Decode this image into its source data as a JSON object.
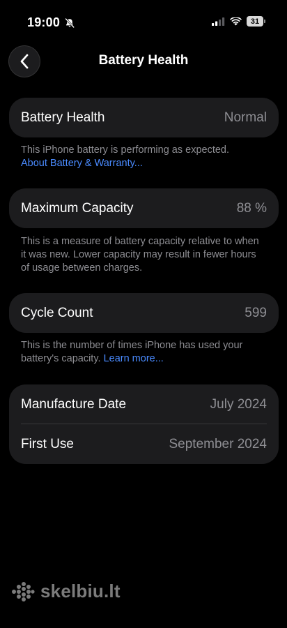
{
  "status_bar": {
    "time": "19:00",
    "battery_level": "31"
  },
  "nav": {
    "title": "Battery Health"
  },
  "battery_health": {
    "label": "Battery Health",
    "value": "Normal",
    "note": "This iPhone battery is performing as expected.",
    "link": "About Battery & Warranty..."
  },
  "max_capacity": {
    "label": "Maximum Capacity",
    "value": "88 %",
    "note": "This is a measure of battery capacity relative to when it was new. Lower capacity may result in fewer hours of usage between charges."
  },
  "cycle_count": {
    "label": "Cycle Count",
    "value": "599",
    "note": "This is the number of times iPhone has used your battery's capacity.",
    "link": "Learn more..."
  },
  "dates": {
    "manufacture_label": "Manufacture Date",
    "manufacture_value": "July 2024",
    "first_use_label": "First Use",
    "first_use_value": "September 2024"
  },
  "watermark": {
    "text": "skelbiu.lt"
  },
  "icons": {
    "back": "chevron-left-icon",
    "silent": "bell-slash-icon",
    "signal": "cellular-signal-icon",
    "wifi": "wifi-icon",
    "battery": "battery-icon"
  },
  "colors": {
    "background": "#000000",
    "card": "#1c1c1e",
    "secondary_text": "#8e8e93",
    "link": "#4a8bff"
  }
}
